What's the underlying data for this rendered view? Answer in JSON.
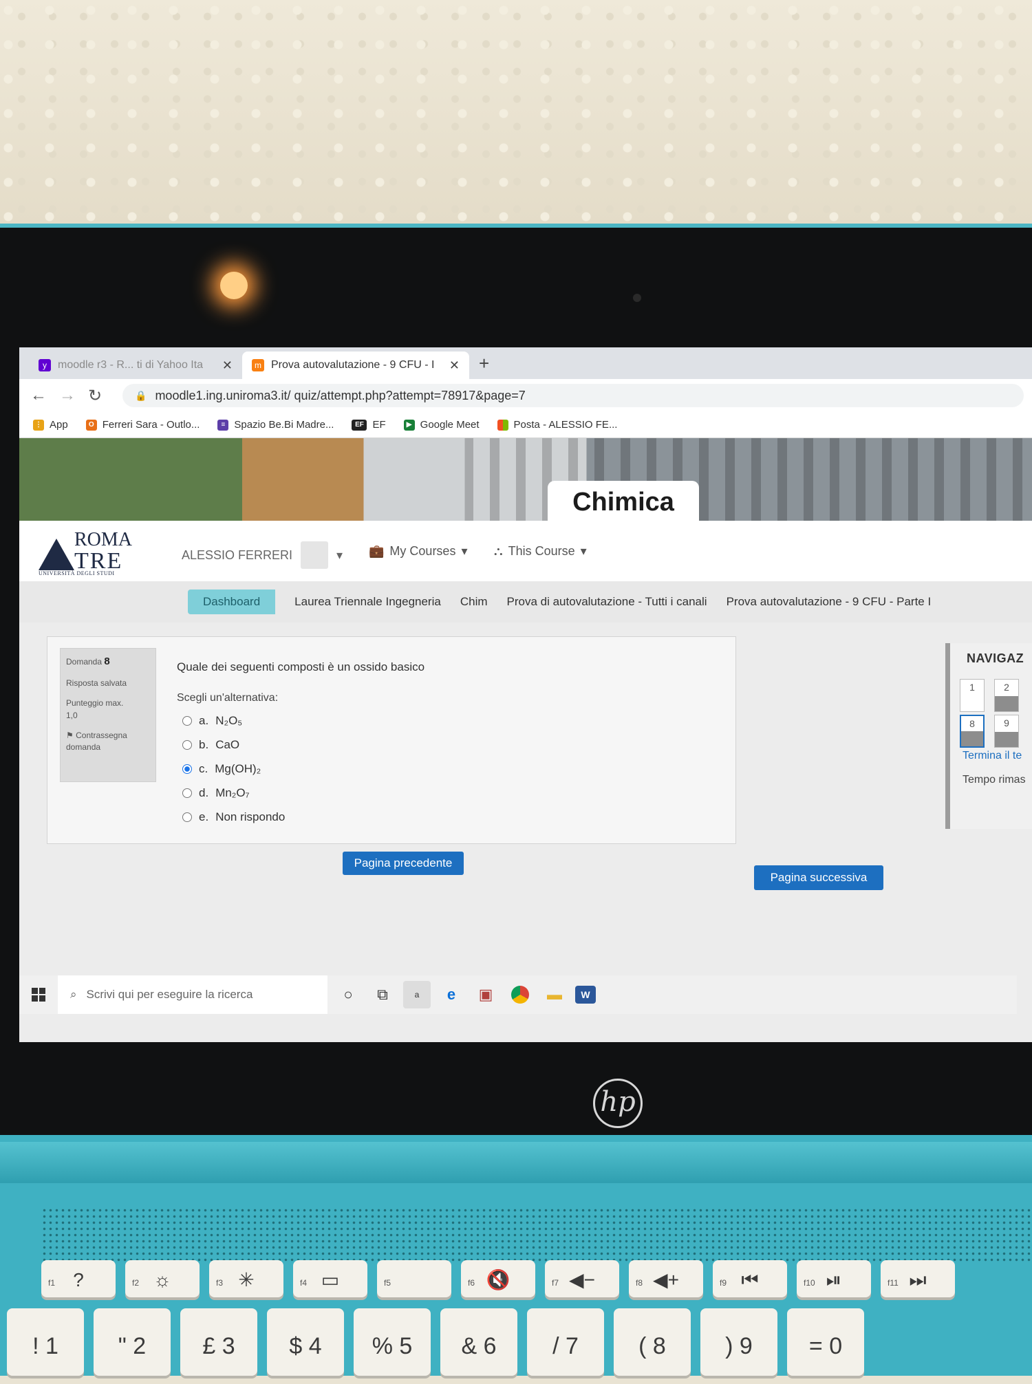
{
  "browser": {
    "tabs": [
      {
        "title": "moodle r3 - R... ti di Yahoo Ita",
        "favicon": "yahoo-icon",
        "active": false
      },
      {
        "title": "Prova autovalutazione - 9 CFU - I",
        "favicon": "moodle-icon",
        "active": true
      }
    ],
    "close_glyph": "✕",
    "new_tab_glyph": "+",
    "url": "moodle1.ing.uniroma3.it/ quiz/attempt.php?attempt=78917&page=7",
    "bookmarks": [
      {
        "label": "App",
        "icon": "apps-grid-icon",
        "color": "#e8a317"
      },
      {
        "label": "Ferreri Sara - Outlo...",
        "icon": "office-icon",
        "color": "#e86f17"
      },
      {
        "label": "Spazio Be.Bi Madre...",
        "icon": "forms-icon",
        "color": "#5c3ea8"
      },
      {
        "label": "EF",
        "icon": "ef-icon",
        "color": "#222222"
      },
      {
        "label": "Google Meet",
        "icon": "meet-icon",
        "color": "#188038"
      },
      {
        "label": "Posta - ALESSIO FE...",
        "icon": "microsoft-icon",
        "color": "#f25022"
      }
    ]
  },
  "moodle": {
    "course_title": "Chimica",
    "logo": {
      "line1": "ROMA",
      "line2": "TRE",
      "sub": "UNIVERSITÀ DEGLI STUDI"
    },
    "user_name": "ALESSIO FERRERI",
    "nav": {
      "my_courses": "My Courses",
      "this_course": "This Course"
    },
    "breadcrumb": [
      "Dashboard",
      "Laurea Triennale Ingegneria",
      "Chim",
      "Prova di autovalutazione - Tutti i canali",
      "Prova autovalutazione - 9 CFU - Parte I"
    ]
  },
  "question": {
    "number_label": "Domanda",
    "number": "8",
    "status": "Risposta salvata",
    "max_score_label": "Punteggio max.",
    "max_score": "1,0",
    "flag_label": "Contrassegna domanda",
    "text": "Quale dei seguenti composti è un ossido basico",
    "prompt": "Scegli un'alternativa:",
    "options": [
      {
        "letter": "a.",
        "formula": "N₂O₅",
        "checked": false
      },
      {
        "letter": "b.",
        "formula": "CaO",
        "checked": false
      },
      {
        "letter": "c.",
        "formula": "Mg(OH)₂",
        "checked": true
      },
      {
        "letter": "d.",
        "formula": "Mn₂O₇",
        "checked": false
      },
      {
        "letter": "e.",
        "formula": "Non rispondo",
        "checked": false
      }
    ]
  },
  "buttons": {
    "prev": "Pagina precedente",
    "next": "Pagina successiva"
  },
  "quiz_navigation": {
    "title": "NAVIGAZ",
    "items": [
      "1",
      "2",
      "8",
      "9"
    ],
    "finish": "Termina il te",
    "time_left": "Tempo rimas"
  },
  "taskbar": {
    "search_placeholder": "Scrivi qui per eseguire la ricerca",
    "icons": [
      "cortana-icon",
      "task-view-icon",
      "amazon-icon",
      "edge-icon",
      "photos-icon",
      "chrome-icon",
      "file-explorer-icon",
      "word-icon"
    ]
  },
  "keyboard": {
    "fn_row": [
      {
        "fn": "f1",
        "label": "?"
      },
      {
        "fn": "f2",
        "label": "☼"
      },
      {
        "fn": "f3",
        "label": "✳"
      },
      {
        "fn": "f4",
        "label": "▭"
      },
      {
        "fn": "f5",
        "label": ""
      },
      {
        "fn": "f6",
        "label": "🔇"
      },
      {
        "fn": "f7",
        "label": "◀−"
      },
      {
        "fn": "f8",
        "label": "◀+"
      },
      {
        "fn": "f9",
        "label": "⏮"
      },
      {
        "fn": "f10",
        "label": "⏯"
      },
      {
        "fn": "f11",
        "label": "⏭"
      }
    ],
    "num_row": [
      "! 1",
      "\" 2",
      "£ 3",
      "$ 4",
      "% 5",
      "& 6",
      "/ 7",
      "( 8",
      ") 9",
      "= 0"
    ]
  },
  "brand": "hp"
}
